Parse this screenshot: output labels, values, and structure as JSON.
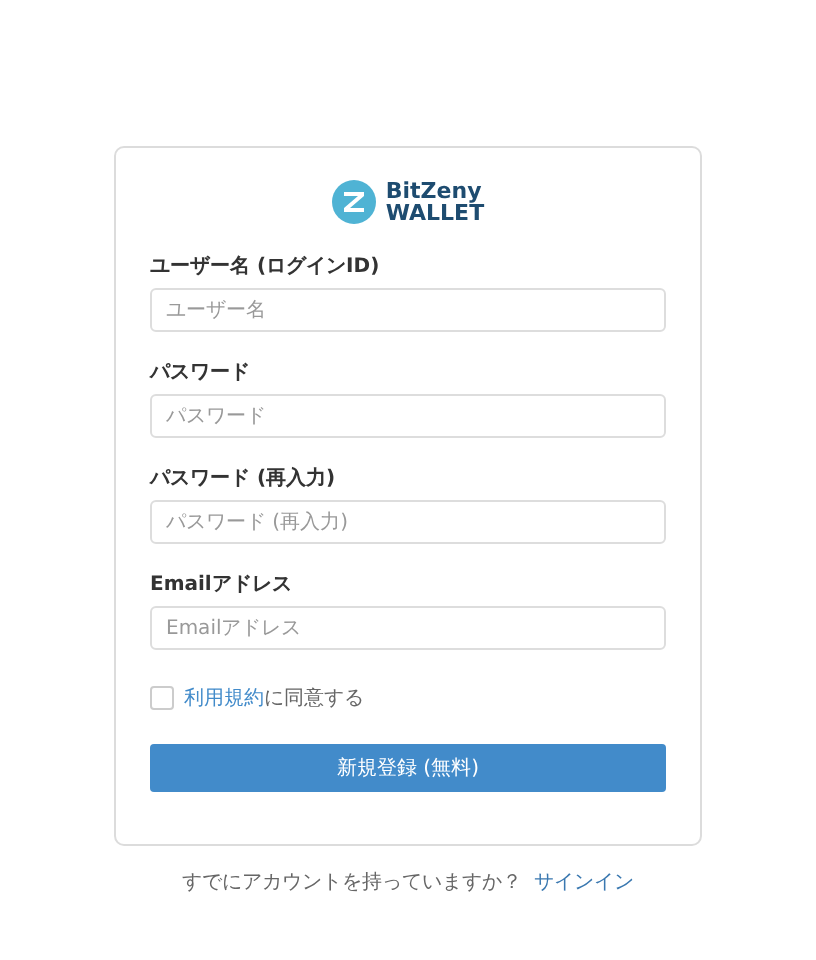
{
  "logo": {
    "name": "BitZeny",
    "subtitle": "WALLET"
  },
  "fields": [
    {
      "label": "ユーザー名 (ログインID)",
      "placeholder": "ユーザー名"
    },
    {
      "label": "パスワード",
      "placeholder": "パスワード"
    },
    {
      "label": "パスワード (再入力)",
      "placeholder": "パスワード (再入力)"
    },
    {
      "label": "Emailアドレス",
      "placeholder": "Emailアドレス"
    }
  ],
  "terms": {
    "link": "利用規約",
    "text": "に同意する",
    "checked": false
  },
  "submit": "新規登録 (無料)",
  "footer": {
    "text": "すでにアカウントを持っていますか？",
    "link": "サインイン"
  }
}
